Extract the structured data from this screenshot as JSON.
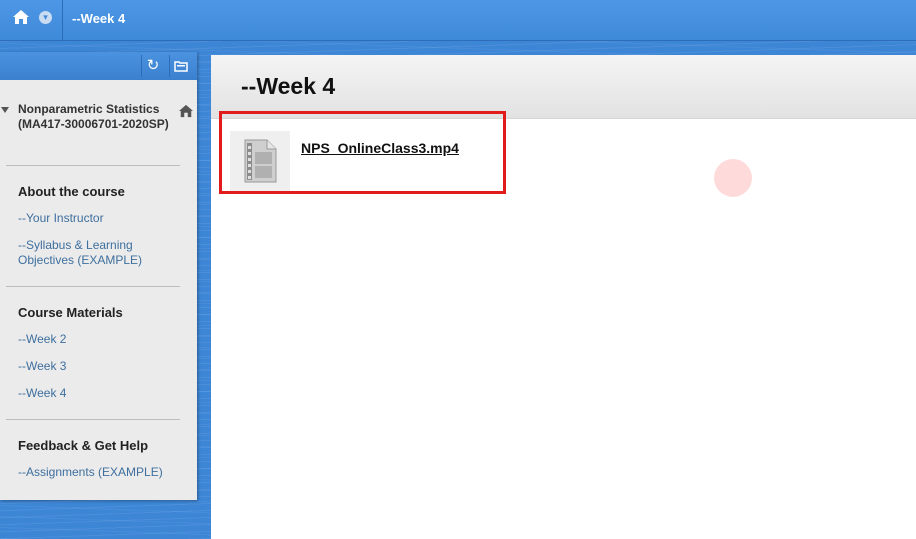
{
  "topbar": {
    "breadcrumb": "--Week 4"
  },
  "course_menu": {
    "course_title": "Nonparametric Statistics (MA417-30006701-2020SP)",
    "sections": [
      {
        "title": "About the course",
        "links": [
          "--Your Instructor",
          "--Syllabus & Learning Objectives (EXAMPLE)"
        ]
      },
      {
        "title": "Course Materials",
        "links": [
          "--Week 2",
          "--Week 3",
          "--Week 4"
        ]
      },
      {
        "title": "Feedback & Get Help",
        "links": [
          "--Assignments (EXAMPLE)"
        ]
      }
    ]
  },
  "content": {
    "page_title": "--Week 4",
    "items": [
      {
        "icon": "video-file-icon",
        "name": "NPS_OnlineClass3.mp4"
      }
    ]
  },
  "colors": {
    "topbar": "#4a93e2",
    "highlight_border": "#e21b1b",
    "link": "#3e6f9e"
  }
}
